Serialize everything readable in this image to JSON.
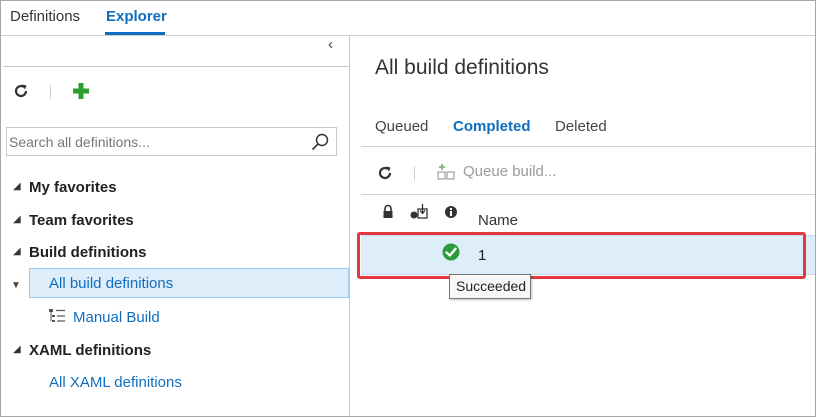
{
  "top_tabs": [
    {
      "label": "Definitions"
    },
    {
      "label": "Explorer"
    }
  ],
  "left": {
    "collapse_glyph": "‹",
    "search": {
      "placeholder": "Search all definitions...",
      "value": ""
    },
    "tree": [
      {
        "label": "My favorites"
      },
      {
        "label": "Team favorites"
      },
      {
        "label": "Build definitions"
      },
      {
        "label": "All build definitions"
      },
      {
        "label": "Manual Build"
      },
      {
        "label": "XAML definitions"
      },
      {
        "label": "All XAML definitions"
      }
    ]
  },
  "main": {
    "title": "All build definitions",
    "tabs": [
      {
        "label": "Queued"
      },
      {
        "label": "Completed"
      },
      {
        "label": "Deleted"
      }
    ],
    "toolbar": {
      "queue_label": "Queue build..."
    },
    "table": {
      "columns": [
        "Name"
      ],
      "rows": [
        {
          "name": "1",
          "status": "succeeded"
        }
      ]
    },
    "tooltip": "Succeeded"
  },
  "colors": {
    "accent": "#106ebe",
    "success": "#2a9c3d",
    "highlight": "#e0393e",
    "selection": "#deedfa"
  },
  "icons": [
    "refresh-icon",
    "add-icon",
    "search-icon",
    "collapse-icon",
    "build-definition-icon",
    "queue-build-icon",
    "lock-icon",
    "retain-icon",
    "info-icon",
    "success-check-icon",
    "tree-expand-icon",
    "tree-expanded-icon"
  ]
}
